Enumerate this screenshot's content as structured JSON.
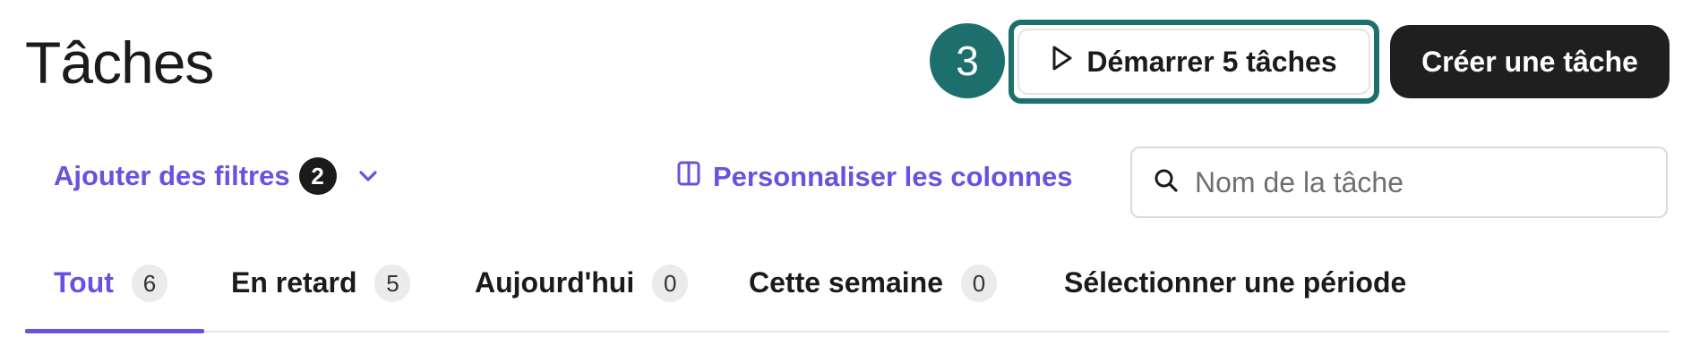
{
  "header": {
    "title": "Tâches",
    "step_number": "3",
    "start_button_label": "Démarrer 5 tâches",
    "create_button_label": "Créer une tâche"
  },
  "toolbar": {
    "filters_label": "Ajouter des filtres",
    "filters_count": "2",
    "columns_label": "Personnaliser les colonnes",
    "search_placeholder": "Nom de la tâche",
    "search_value": ""
  },
  "tabs": [
    {
      "label": "Tout",
      "count": "6",
      "active": true
    },
    {
      "label": "En retard",
      "count": "5",
      "active": false
    },
    {
      "label": "Aujourd'hui",
      "count": "0",
      "active": false
    },
    {
      "label": "Cette semaine",
      "count": "0",
      "active": false
    },
    {
      "label": "Sélectionner une période",
      "count": "",
      "active": false
    }
  ],
  "colors": {
    "accent": "#6653e0",
    "highlight": "#1d6f6e",
    "dark_button": "#1f1f1f"
  },
  "icons": {
    "start": "play-icon",
    "filters": "chevron-down-icon",
    "columns": "columns-icon",
    "search": "search-icon"
  }
}
